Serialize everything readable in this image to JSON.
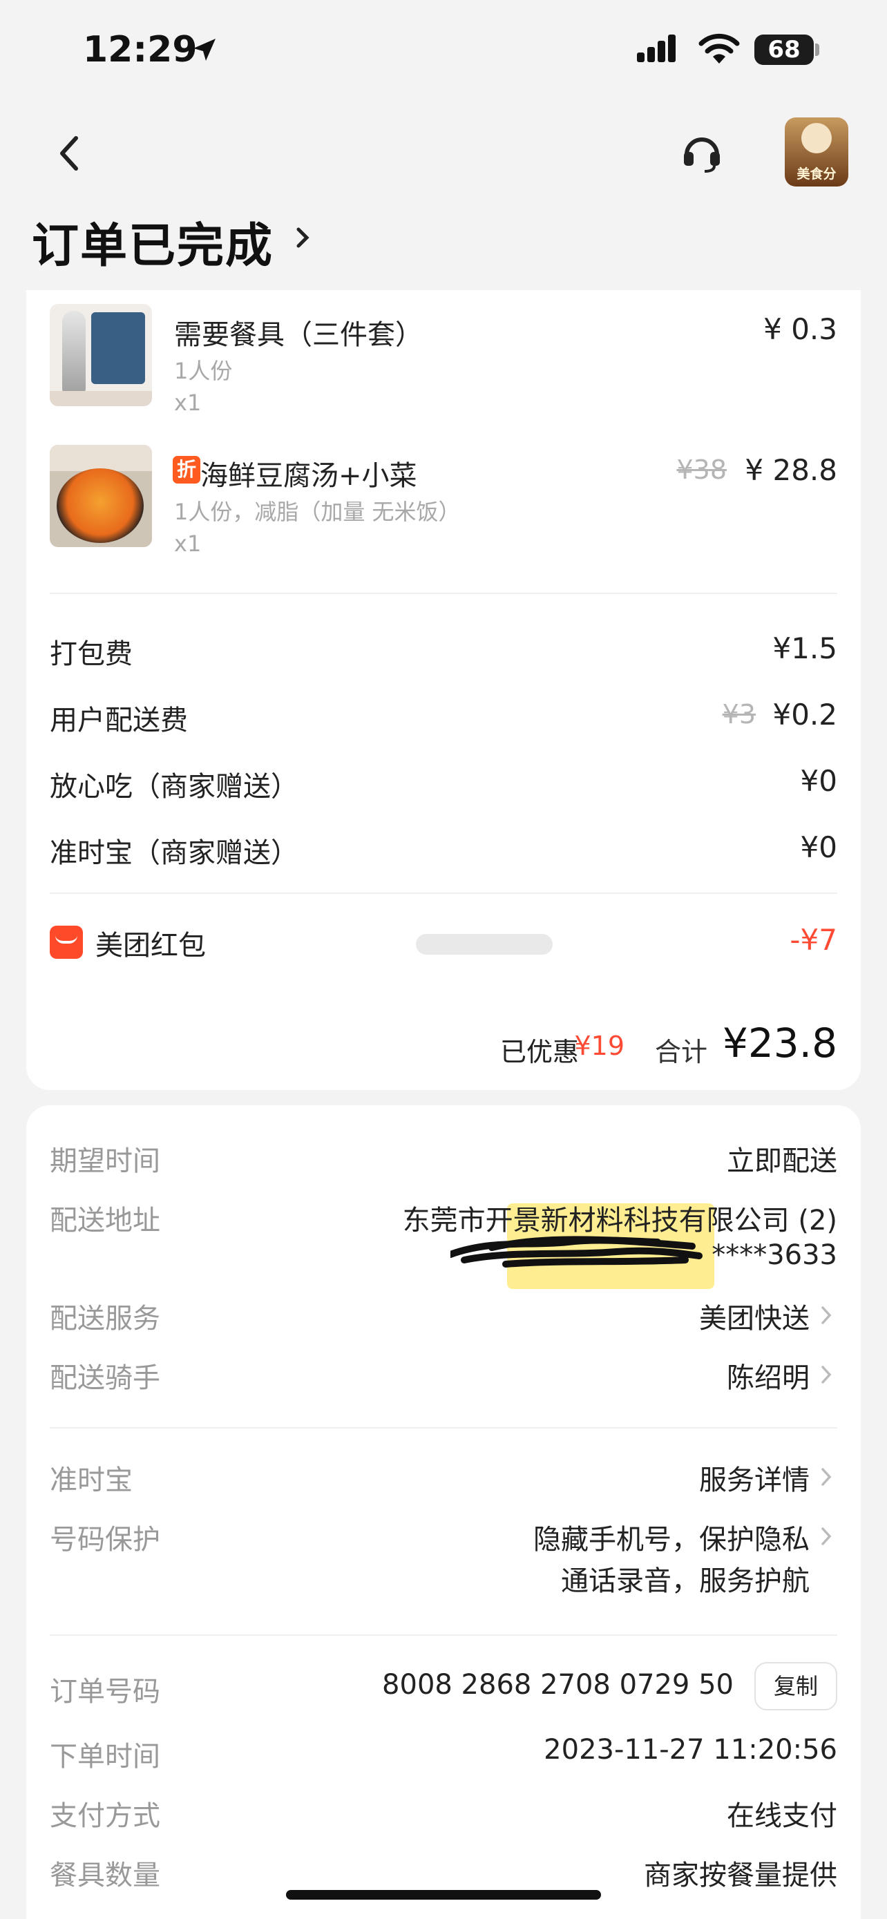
{
  "status_bar": {
    "time": "12:29",
    "battery": "68"
  },
  "header": {
    "title": "订单已完成",
    "badge_label": "美食分"
  },
  "items": [
    {
      "name": "需要餐具（三件套）",
      "spec": "1人份",
      "qty": "x1",
      "price": "¥ 0.3",
      "original_price": "",
      "tag": ""
    },
    {
      "name": "海鲜豆腐汤+小菜",
      "spec": "1人份，减脂（加量 无米饭）",
      "qty": "x1",
      "price": "¥ 28.8",
      "original_price": "¥38",
      "tag": "折"
    }
  ],
  "fees": [
    {
      "label": "打包费",
      "value": "¥1.5",
      "original": ""
    },
    {
      "label": "用户配送费",
      "value": "¥0.2",
      "original": "¥3"
    },
    {
      "label": "放心吃（商家赠送）",
      "value": "¥0",
      "original": ""
    },
    {
      "label": "准时宝（商家赠送）",
      "value": "¥0",
      "original": ""
    }
  ],
  "red_packet": {
    "label": "美团红包",
    "value": "-¥7"
  },
  "summary": {
    "discount_label": "已优惠",
    "discount_value": "¥19",
    "total_label": "合计",
    "total_value": "¥23.8"
  },
  "delivery": {
    "expected_time": {
      "label": "期望时间",
      "value": "立即配送"
    },
    "address": {
      "label": "配送地址",
      "value": "东莞市开景新材料科技有限公司 (2)",
      "phone": "****3633"
    },
    "service": {
      "label": "配送服务",
      "value": "美团快送"
    },
    "rider": {
      "label": "配送骑手",
      "value": "陈绍明"
    }
  },
  "protection": {
    "ontime": {
      "label": "准时宝",
      "value": "服务详情"
    },
    "number": {
      "label": "号码保护",
      "line1": "隐藏手机号，保护隐私",
      "line2": "通话录音，服务护航"
    }
  },
  "order": {
    "number": {
      "label": "订单号码",
      "value": "8008 2868 2708 0729 50",
      "copy_label": "复制"
    },
    "time": {
      "label": "下单时间",
      "value": "2023-11-27 11:20:56"
    },
    "payment": {
      "label": "支付方式",
      "value": "在线支付"
    },
    "utensils": {
      "label": "餐具数量",
      "value": "商家按餐量提供"
    }
  },
  "colors": {
    "accent": "#ff4b33",
    "tag": "#ff5a1f",
    "highlight": "#ffe14a"
  }
}
